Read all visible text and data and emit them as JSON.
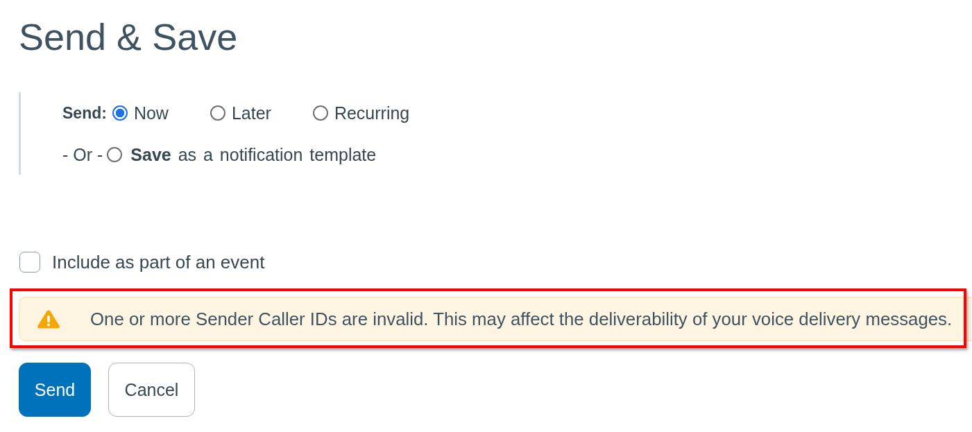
{
  "title": "Send & Save",
  "schedule": {
    "label": "Send:",
    "options": [
      {
        "label": "Now",
        "selected": true
      },
      {
        "label": "Later",
        "selected": false
      },
      {
        "label": "Recurring",
        "selected": false
      }
    ]
  },
  "save_option": {
    "prefix": "- Or -",
    "label": "**Save** as a notification template",
    "selected": false
  },
  "event_checkbox": {
    "label": "Include as part of an event",
    "checked": false
  },
  "alert": {
    "kind": "warning",
    "message": "One or more Sender Caller IDs are invalid. This may affect the deliverability of your voice delivery messages.",
    "highlighted": true
  },
  "buttons": [
    {
      "label": "Send",
      "kind": "primary"
    },
    {
      "label": "Cancel",
      "kind": "secondary"
    }
  ]
}
